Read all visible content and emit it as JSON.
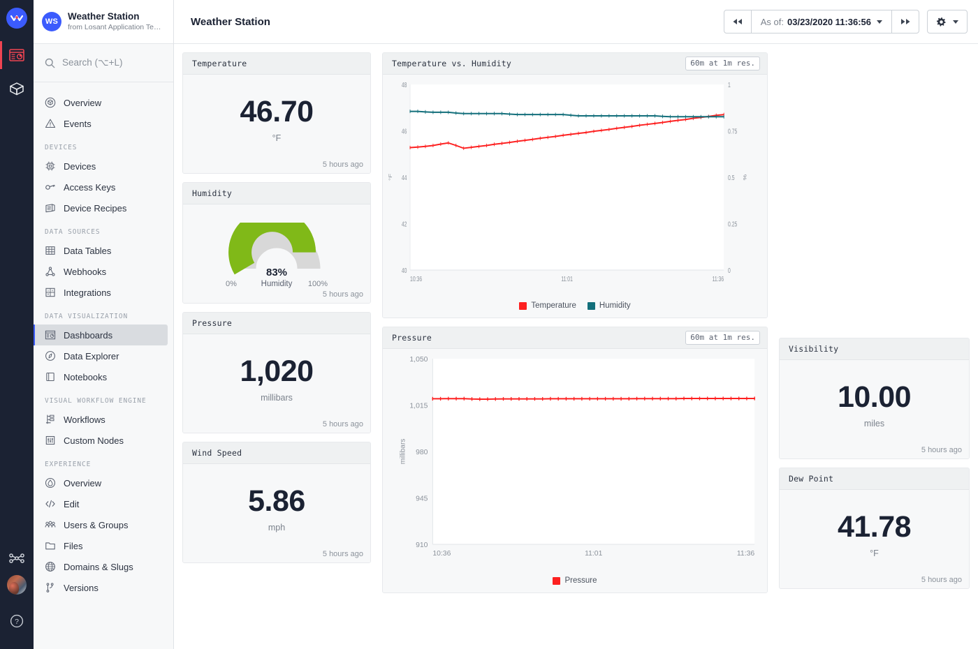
{
  "rail": {
    "logo_icon": "losant-logo-icon",
    "items": [
      {
        "icon": "dashboard-icon",
        "name": "rail-item-dashboards",
        "active": true
      },
      {
        "icon": "package-icon",
        "name": "rail-item-applications",
        "active": false
      }
    ],
    "workflow_icon": "workflow-node-icon",
    "avatar_icon": "user-avatar",
    "help_icon": "help-circle-icon"
  },
  "sidebar": {
    "app_badge": "WS",
    "app_name": "Weather Station",
    "app_subtitle": "from Losant Application Tem...",
    "search_placeholder": "Search (⌥+L)",
    "search_icon": "search-icon",
    "groups": [
      {
        "label": "",
        "items": [
          {
            "label": "Overview",
            "icon": "cube-outline-icon",
            "active": false
          },
          {
            "label": "Events",
            "icon": "warning-triangle-icon",
            "active": false
          }
        ]
      },
      {
        "label": "DEVICES",
        "items": [
          {
            "label": "Devices",
            "icon": "chip-icon",
            "active": false
          },
          {
            "label": "Access Keys",
            "icon": "key-icon",
            "active": false
          },
          {
            "label": "Device Recipes",
            "icon": "recipe-card-icon",
            "active": false
          }
        ]
      },
      {
        "label": "DATA SOURCES",
        "items": [
          {
            "label": "Data Tables",
            "icon": "table-grid-icon",
            "active": false
          },
          {
            "label": "Webhooks",
            "icon": "webhook-icon",
            "active": false
          },
          {
            "label": "Integrations",
            "icon": "integrations-icon",
            "active": false
          }
        ]
      },
      {
        "label": "DATA VISUALIZATION",
        "items": [
          {
            "label": "Dashboards",
            "icon": "dashboard-icon",
            "active": true
          },
          {
            "label": "Data Explorer",
            "icon": "compass-icon",
            "active": false
          },
          {
            "label": "Notebooks",
            "icon": "notebook-icon",
            "active": false
          }
        ]
      },
      {
        "label": "VISUAL WORKFLOW ENGINE",
        "items": [
          {
            "label": "Workflows",
            "icon": "workflow-icon",
            "active": false
          },
          {
            "label": "Custom Nodes",
            "icon": "custom-node-icon",
            "active": false
          }
        ]
      },
      {
        "label": "EXPERIENCE",
        "items": [
          {
            "label": "Overview",
            "icon": "droplet-circle-icon",
            "active": false
          },
          {
            "label": "Edit",
            "icon": "code-slash-icon",
            "active": false
          },
          {
            "label": "Users & Groups",
            "icon": "users-group-icon",
            "active": false
          },
          {
            "label": "Files",
            "icon": "folder-icon",
            "active": false
          },
          {
            "label": "Domains & Slugs",
            "icon": "globe-icon",
            "active": false
          },
          {
            "label": "Versions",
            "icon": "branch-icon",
            "active": false
          }
        ]
      }
    ]
  },
  "topbar": {
    "title": "Weather Station",
    "prev_icon": "skip-back-icon",
    "next_icon": "skip-forward-icon",
    "asof_label": "As of:",
    "asof_value": "03/23/2020 11:36:56",
    "gear_icon": "gear-icon",
    "dropdown_icon": "chevron-down-icon"
  },
  "cards": {
    "temperature": {
      "title": "Temperature",
      "value": "46.70",
      "unit": "°F",
      "timestamp": "5 hours ago"
    },
    "humidity": {
      "title": "Humidity",
      "percent": "83%",
      "center_label": "Humidity",
      "min_label": "0%",
      "max_label": "100%",
      "fill_value": 83,
      "fill_color": "#80b918",
      "track_color": "#d8d8d8",
      "timestamp": "5 hours ago"
    },
    "pressure": {
      "title": "Pressure",
      "value": "1,020",
      "unit": "millibars",
      "timestamp": "5 hours ago"
    },
    "wind_speed": {
      "title": "Wind Speed",
      "value": "5.86",
      "unit": "mph",
      "timestamp": "5 hours ago"
    },
    "visibility": {
      "title": "Visibility",
      "value": "10.00",
      "unit": "miles",
      "timestamp": "5 hours ago"
    },
    "dew_point": {
      "title": "Dew Point",
      "value": "41.78",
      "unit": "°F",
      "timestamp": "5 hours ago"
    }
  },
  "charts": {
    "temp_humidity": {
      "title": "Temperature vs. Humidity",
      "resolution": "60m at 1m res."
    },
    "pressure": {
      "title": "Pressure",
      "resolution": "60m at 1m res."
    }
  },
  "chart_data": [
    {
      "type": "line",
      "title": "Temperature vs. Humidity",
      "xlabel": "",
      "ylabel": "°F",
      "y2label": "%",
      "ylim": [
        40,
        48
      ],
      "y2lim": [
        0,
        1
      ],
      "yticks": [
        40,
        42,
        44,
        46,
        48
      ],
      "y2ticks": [
        "0",
        "0.25",
        "0.5",
        "0.75",
        "1"
      ],
      "xticks": [
        "10:36",
        "11:01",
        "11:36"
      ],
      "grid": false,
      "legend": "bottom",
      "series": [
        {
          "name": "Temperature",
          "color": "#fd2020",
          "axis": "left",
          "values": [
            45.28,
            45.3,
            45.33,
            45.37,
            45.43,
            45.48,
            45.37,
            45.25,
            45.29,
            45.33,
            45.37,
            45.42,
            45.46,
            45.5,
            45.55,
            45.59,
            45.63,
            45.68,
            45.72,
            45.76,
            45.81,
            45.85,
            45.89,
            45.93,
            45.98,
            46.02,
            46.06,
            46.11,
            46.15,
            46.19,
            46.24,
            46.28,
            46.32,
            46.36,
            46.41,
            46.45,
            46.49,
            46.54,
            46.58,
            46.62,
            46.67,
            46.7
          ]
        },
        {
          "name": "Humidity",
          "color": "#136f7b",
          "axis": "right",
          "values": [
            0.855,
            0.855,
            0.852,
            0.85,
            0.85,
            0.85,
            0.846,
            0.843,
            0.843,
            0.843,
            0.843,
            0.843,
            0.843,
            0.84,
            0.838,
            0.838,
            0.838,
            0.838,
            0.838,
            0.838,
            0.838,
            0.834,
            0.831,
            0.831,
            0.831,
            0.831,
            0.831,
            0.831,
            0.831,
            0.831,
            0.831,
            0.831,
            0.831,
            0.828,
            0.826,
            0.826,
            0.826,
            0.826,
            0.826,
            0.826,
            0.826,
            0.826
          ]
        }
      ]
    },
    {
      "type": "line",
      "title": "Pressure",
      "xlabel": "",
      "ylabel": "millibars",
      "ylim": [
        910,
        1050
      ],
      "yticks": [
        910,
        945,
        980,
        1015,
        1050
      ],
      "xticks": [
        "10:36",
        "11:01",
        "11:36"
      ],
      "grid": false,
      "legend": "bottom",
      "series": [
        {
          "name": "Pressure",
          "color": "#fd2020",
          "values": [
            1019.8,
            1019.8,
            1019.9,
            1019.9,
            1019.9,
            1019.6,
            1019.5,
            1019.5,
            1019.6,
            1019.7,
            1019.7,
            1019.7,
            1019.7,
            1019.7,
            1019.7,
            1019.8,
            1019.8,
            1019.8,
            1019.8,
            1019.8,
            1019.8,
            1019.8,
            1019.8,
            1019.8,
            1019.8,
            1019.8,
            1019.9,
            1019.9,
            1019.9,
            1019.9,
            1019.9,
            1019.9,
            1020.0,
            1020.0,
            1020.0,
            1020.0,
            1020.0,
            1020.0,
            1020.0,
            1020.0,
            1020.0,
            1020.0
          ]
        }
      ]
    }
  ],
  "colors": {
    "accent_blue": "#3b5bfd",
    "accent_red": "#ef4452",
    "temperature": "#fd2020",
    "humidity": "#136f7b",
    "gauge_green": "#80b918"
  }
}
